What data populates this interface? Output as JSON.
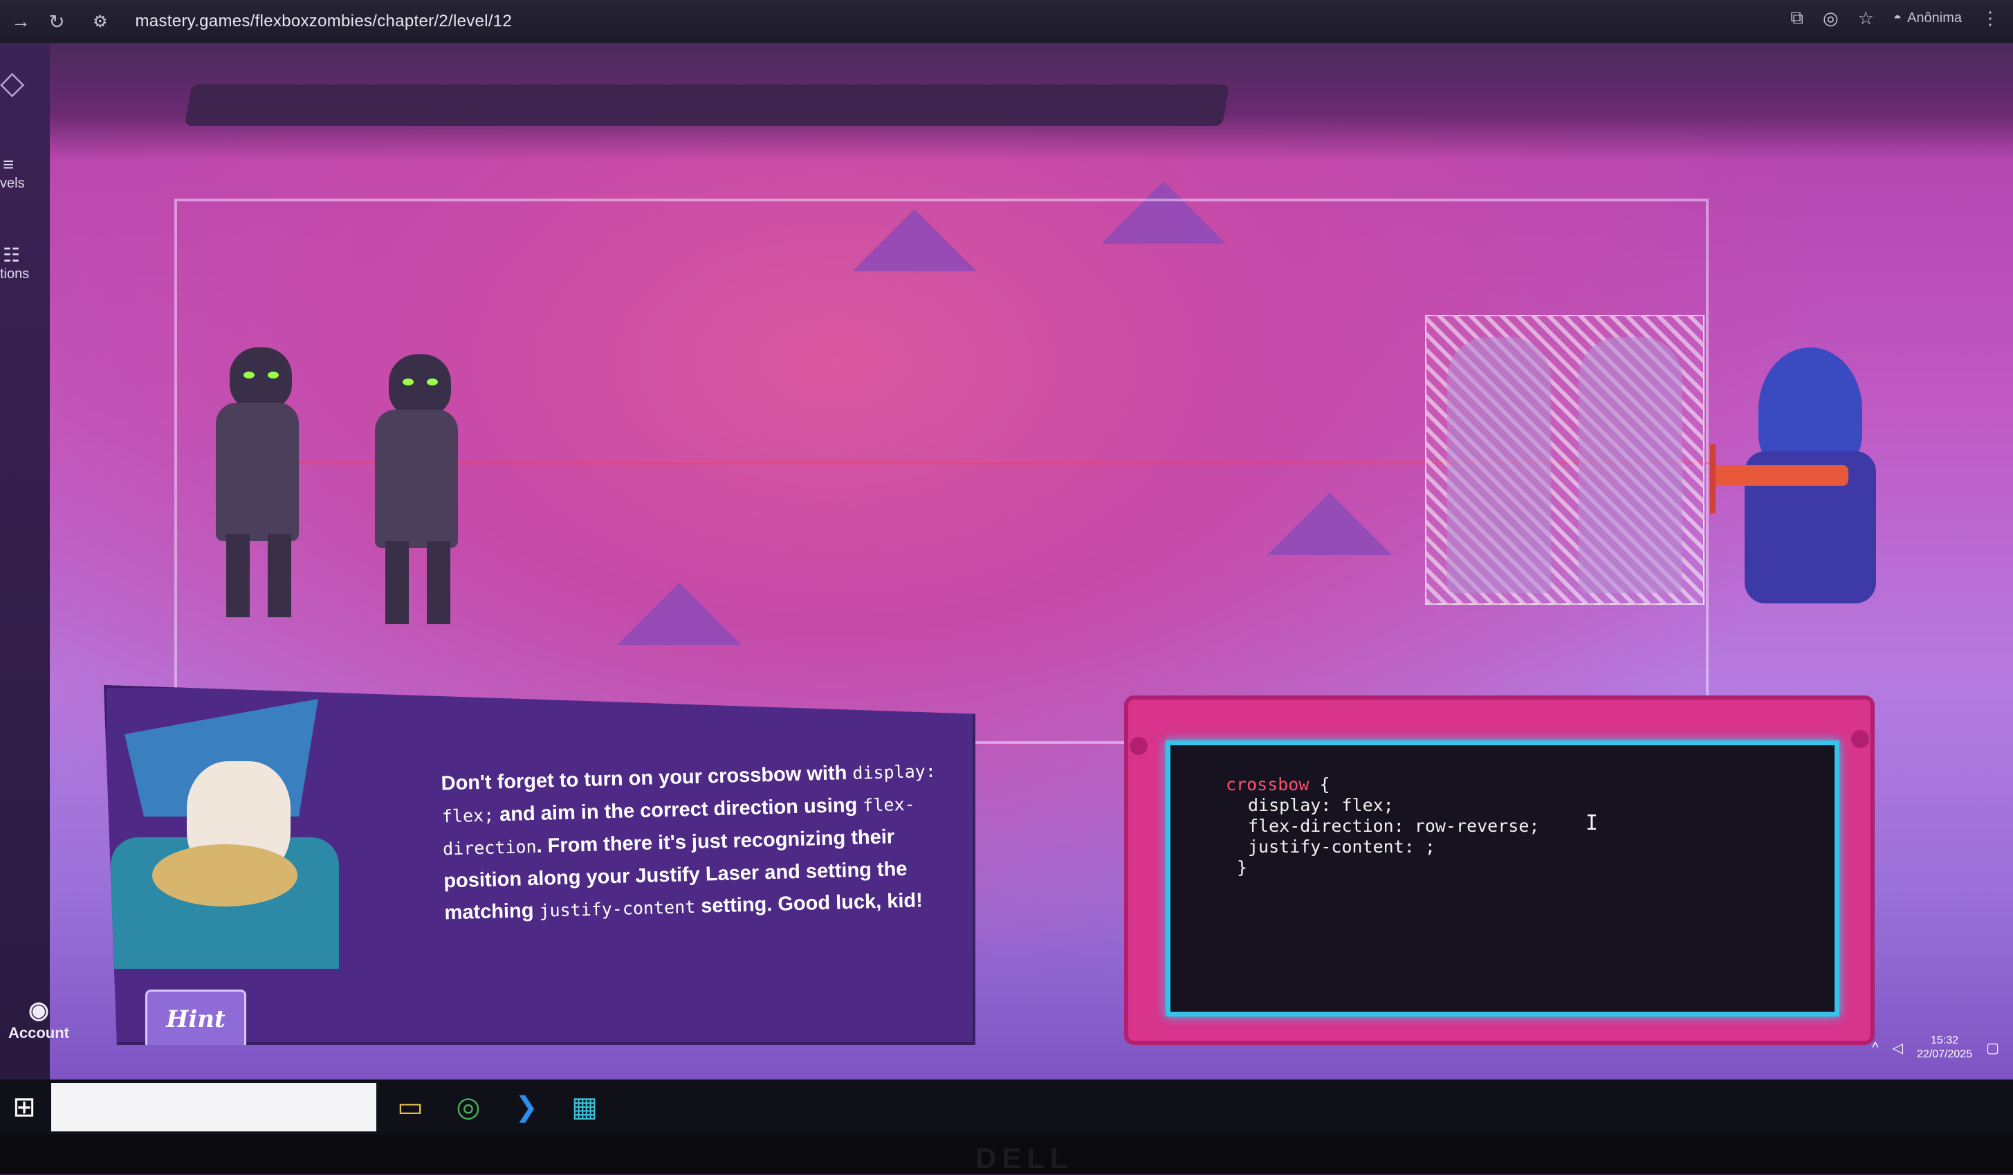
{
  "browser": {
    "url": "mastery.games/flexboxzombies/chapter/2/level/12",
    "profile_label": "Anônima"
  },
  "sidebar": {
    "levels_label": "vels",
    "options_label": "tions",
    "account_label": "Account"
  },
  "dialog": {
    "text_parts": {
      "p1": "Don't forget to turn on your crossbow with ",
      "c1": "display: flex;",
      "p2": " and aim in the correct direction using ",
      "c2": "flex-direction",
      "p3": ". From there it's just recognizing their position along your Justify Laser and setting the matching ",
      "c3": "justify-content",
      "p4": " setting. Good luck, kid!"
    },
    "hint_label": "Hint"
  },
  "editor": {
    "selector": "crossbow",
    "brace_open": " {",
    "line1": "display: flex;",
    "line2": "flex-direction: row-reverse;",
    "line3": "justify-content: ;",
    "brace_close": "}"
  },
  "tray": {
    "time": "15:32",
    "date": "22/07/2025"
  },
  "monitor": {
    "brand": "DELL"
  },
  "colors": {
    "editor_border": "#35c3ea",
    "editor_frame": "#d8348c",
    "dialog_bg": "#4e2a86",
    "selector": "#ff4f6e"
  },
  "icons": [
    "back-icon",
    "reload-icon",
    "site-settings-icon",
    "translate-icon",
    "eye-off-icon",
    "star-icon",
    "incognito-icon",
    "menu-icon",
    "logo-icon",
    "levels-icon",
    "options-icon",
    "account-icon",
    "windows-start-icon",
    "file-explorer-icon",
    "chrome-icon",
    "vscode-icon",
    "calendar-icon"
  ]
}
